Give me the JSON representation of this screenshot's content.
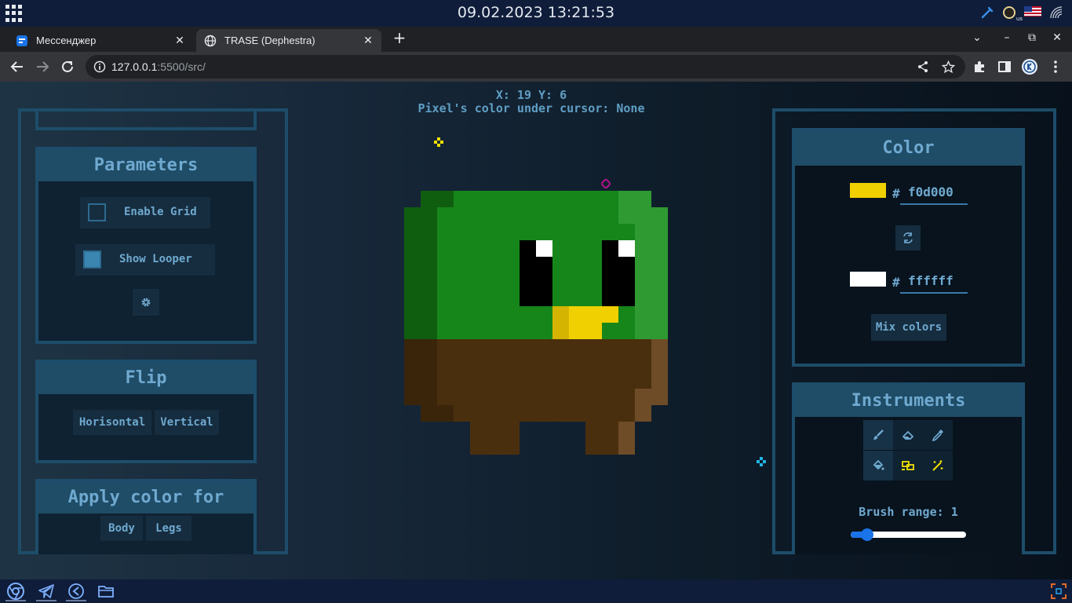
{
  "system": {
    "clock": "09.02.2023 13:21:53",
    "keyboard_layout": "us"
  },
  "browser": {
    "tabs": [
      {
        "title": "Мессенджер",
        "icon": "messenger-icon",
        "active": false
      },
      {
        "title": "TRASE (Dephestra)",
        "icon": "globe-icon",
        "active": true
      }
    ],
    "url_host": "127.0.0.1",
    "url_path": ":5500/src/"
  },
  "status": {
    "coords_line": "X: 19 Y: 6",
    "color_line": "Pixel's color under cursor: None"
  },
  "parameters": {
    "title": "Parameters",
    "enable_grid": {
      "label": "Enable Grid",
      "checked": false
    },
    "show_looper": {
      "label": "Show Looper",
      "checked": true
    },
    "settings_icon": "gear-icon"
  },
  "flip": {
    "title": "Flip",
    "horizontal": "Horisontal",
    "vertical": "Vertical"
  },
  "apply_color": {
    "title": "Apply color for",
    "body": "Body",
    "legs": "Legs"
  },
  "color": {
    "title": "Color",
    "primary_hex": "f0d000",
    "primary_color": "#f0d000",
    "secondary_hex": "ffffff",
    "secondary_color": "#ffffff",
    "hash": "#",
    "mix_label": "Mix colors",
    "swap_icon": "swap-icon"
  },
  "instruments": {
    "title": "Instruments",
    "tools": [
      {
        "name": "brush-icon",
        "selected": true
      },
      {
        "name": "eraser-icon",
        "selected": false
      },
      {
        "name": "eyedropper-icon",
        "selected": false
      },
      {
        "name": "fill-bucket-icon",
        "selected": true
      },
      {
        "name": "transform-icon",
        "selected": false
      },
      {
        "name": "magic-wand-icon",
        "selected": false
      }
    ],
    "brush_range_label": "Brush range:",
    "brush_range_value": "1",
    "brush_range_fraction": 0.1
  },
  "palette": {
    "accent": "#6fa9d0",
    "panel_border": "#1d4d6a",
    "yellow_marker": "#f0e000",
    "pink_marker": "#b0148c",
    "cyan_marker": "#22b4e6"
  },
  "taskbar": [
    "chrome-icon",
    "telegram-icon",
    "vscode-icon",
    "files-icon"
  ]
}
